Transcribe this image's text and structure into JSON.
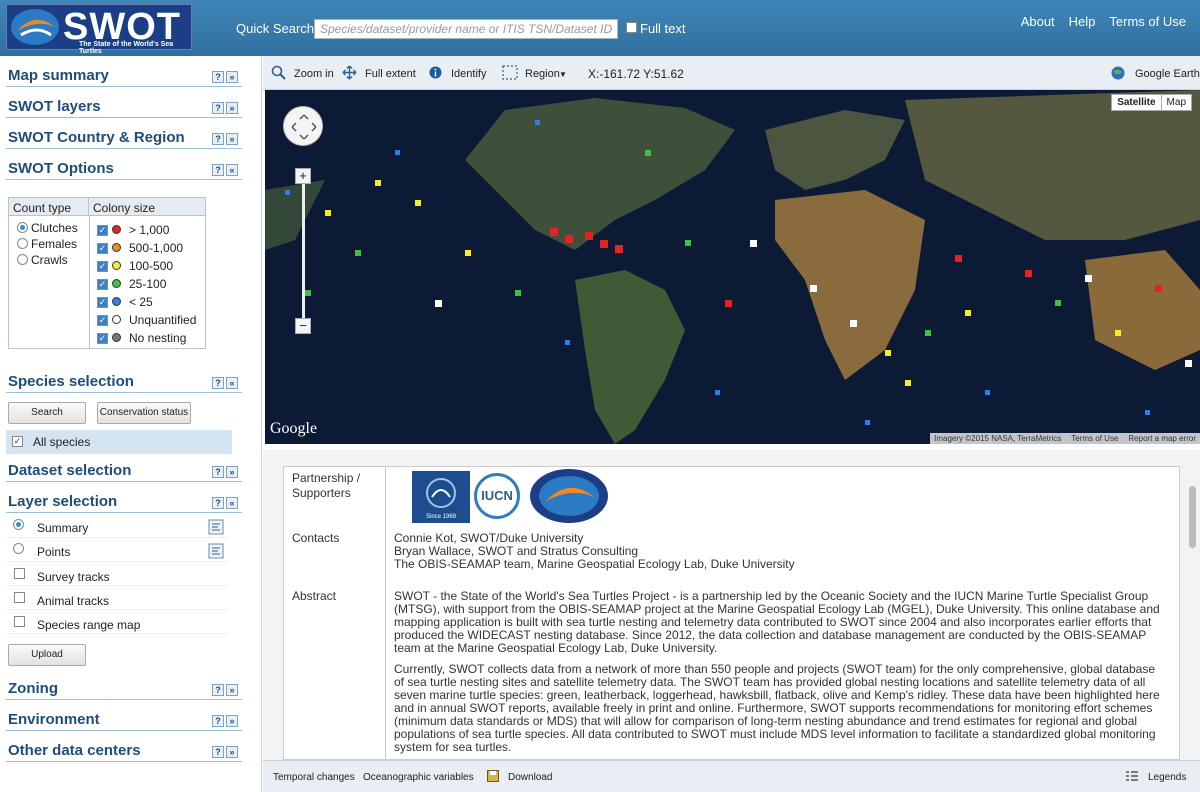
{
  "header": {
    "logo_text": "SWOT",
    "logo_subtitle": "The State of the World's Sea Turtles",
    "quick_search_label": "Quick Search",
    "search_placeholder": "Species/dataset/provider name or ITIS TSN/Dataset ID",
    "full_text_label": "Full text",
    "links": [
      "About",
      "Help",
      "Terms of Use"
    ]
  },
  "sidebar": {
    "sections_top": [
      "Map summary",
      "SWOT layers",
      "SWOT Country & Region",
      "SWOT Options"
    ],
    "options": {
      "count_type_header": "Count type",
      "colony_size_header": "Colony size",
      "count_types": [
        {
          "label": "Clutches",
          "selected": true
        },
        {
          "label": "Females",
          "selected": false
        },
        {
          "label": "Crawls",
          "selected": false
        }
      ],
      "colony_sizes": [
        {
          "label": "> 1,000",
          "color": "#e32323"
        },
        {
          "label": "500-1,000",
          "color": "#f08a24"
        },
        {
          "label": "100-500",
          "color": "#f2ee2a"
        },
        {
          "label": "25-100",
          "color": "#3dc33d"
        },
        {
          "label": "< 25",
          "color": "#2f7fe0"
        },
        {
          "label": "Unquantified",
          "color": "#ffffff"
        },
        {
          "label": "No nesting",
          "color": "#777777"
        }
      ]
    },
    "species_selection": {
      "title": "Species selection",
      "search_button": "Search",
      "conservation_button": "Conservation status",
      "all_species_label": "All species"
    },
    "dataset_selection_title": "Dataset selection",
    "layer_selection": {
      "title": "Layer selection",
      "items": [
        {
          "label": "Summary",
          "type": "radio",
          "selected": true,
          "has_tool": true
        },
        {
          "label": "Points",
          "type": "radio",
          "selected": false,
          "has_tool": true
        },
        {
          "label": "Survey tracks",
          "type": "checkbox",
          "selected": false
        },
        {
          "label": "Animal tracks",
          "type": "checkbox",
          "selected": false
        },
        {
          "label": "Species range map",
          "type": "checkbox",
          "selected": false
        }
      ],
      "upload_button": "Upload"
    },
    "sections_bottom": [
      "Zoning",
      "Environment",
      "Other data centers"
    ]
  },
  "map_toolbar": {
    "zoom_in": "Zoom in",
    "full_extent": "Full extent",
    "identify": "Identify",
    "region": "Region",
    "coords": "X:-161.72 Y:51.62",
    "google_earth": "Google Earth"
  },
  "map": {
    "satellite_label": "Satellite",
    "map_label": "Map",
    "google_logo": "Google",
    "attribution": [
      "Imagery ©2015 NASA, TerraMetrics",
      "Terms of Use",
      "Report a map error"
    ]
  },
  "info": {
    "partnership_label": "Partnership / Supporters",
    "logo_texts": [
      "Since 1969",
      "IUCN"
    ],
    "contacts_label": "Contacts",
    "contacts": [
      "Connie Kot, SWOT/Duke University",
      "Bryan Wallace, SWOT and Stratus Consulting",
      "The OBIS-SEAMAP team, Marine Geospatial Ecology Lab, Duke University"
    ],
    "abstract_label": "Abstract",
    "abstract_p1": "SWOT - the State of the World's Sea Turtles Project - is a partnership led by the Oceanic Society and the IUCN Marine Turtle Specialist Group (MTSG), with support from the OBIS-SEAMAP project at the Marine Geospatial Ecology Lab (MGEL), Duke University. This online database and mapping application is built with sea turtle nesting and telemetry data contributed to SWOT since 2004 and also incorporates earlier efforts that produced the WIDECAST nesting database. Since 2012, the data collection and database management are conducted by the OBIS-SEAMAP team at the Marine Geospatial Ecology Lab, Duke University.",
    "abstract_p2": "Currently, SWOT collects data from a network of more than 550 people and projects (SWOT team) for the only comprehensive, global database of sea turtle nesting sites and satellite telemetry data. The SWOT team has provided global nesting locations and satellite telemetry data of all seven marine turtle species: green, leatherback, loggerhead, hawksbill, flatback, olive and Kemp's ridley. These data have been highlighted here and in annual SWOT reports, available freely in print and online. Furthermore, SWOT supports recommendations for monitoring effort schemes (minimum data standards or MDS) that will allow for comparison of long-term nesting abundance and trend estimates for regional and global populations of sea turtle species. All data contributed to SWOT must include MDS level information to facilitate a standardized global monitoring system for sea turtles."
  },
  "bottom_bar": {
    "temporal": "Temporal changes",
    "oceanographic": "Oceanographic variables",
    "download": "Download",
    "legends": "Legends"
  }
}
